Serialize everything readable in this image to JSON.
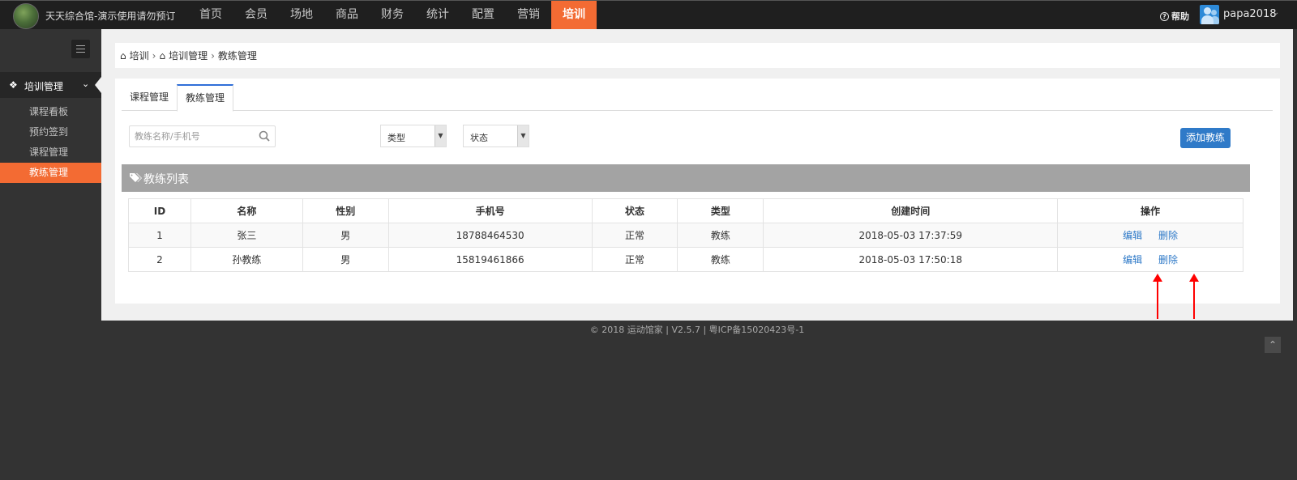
{
  "header": {
    "app_title": "天天综合馆-演示使用请勿预订",
    "nav": [
      "首页",
      "会员",
      "场地",
      "商品",
      "财务",
      "统计",
      "配置",
      "营销",
      "培训"
    ],
    "active_nav": "培训",
    "help_label": "帮助",
    "username": "papa2018"
  },
  "sidebar": {
    "section_label": "培训管理",
    "items": [
      {
        "label": "课程看板"
      },
      {
        "label": "预约签到"
      },
      {
        "label": "课程管理"
      },
      {
        "label": "教练管理"
      }
    ],
    "active_item": "教练管理"
  },
  "breadcrumb": [
    "培训",
    "培训管理",
    "教练管理"
  ],
  "tabs": [
    {
      "label": "课程管理"
    },
    {
      "label": "教练管理"
    }
  ],
  "active_tab": "教练管理",
  "filters": {
    "search_placeholder": "教练名称/手机号",
    "type_value": "类型",
    "status_value": "状态"
  },
  "add_button_label": "添加教练",
  "list_title": "教练列表",
  "table": {
    "headers": [
      "ID",
      "名称",
      "性别",
      "手机号",
      "状态",
      "类型",
      "创建时间",
      "操作"
    ],
    "rows": [
      {
        "id": "1",
        "name": "张三",
        "gender": "男",
        "phone": "18788464530",
        "status": "正常",
        "type": "教练",
        "created": "2018-05-03 17:37:59"
      },
      {
        "id": "2",
        "name": "孙教练",
        "gender": "男",
        "phone": "15819461866",
        "status": "正常",
        "type": "教练",
        "created": "2018-05-03 17:50:18"
      }
    ],
    "edit_label": "编辑",
    "delete_label": "删除"
  },
  "footer_text": "© 2018 运动馆家 | V2.5.7 | 粤ICP备15020423号-1",
  "colors": {
    "accent": "#f36b33",
    "primary_button": "#2f7ac8",
    "annotation_arrow": "#ff0000"
  }
}
